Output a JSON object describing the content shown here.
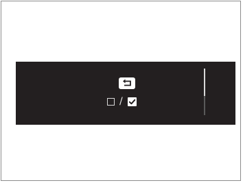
{
  "panel": {
    "separator": "/",
    "icons": {
      "back": "back-return-icon",
      "unchecked": "checkbox-empty-icon",
      "checked": "checkbox-checked-icon"
    }
  },
  "colors": {
    "panel_background": "#231f20",
    "icon_foreground": "#ffffff"
  }
}
